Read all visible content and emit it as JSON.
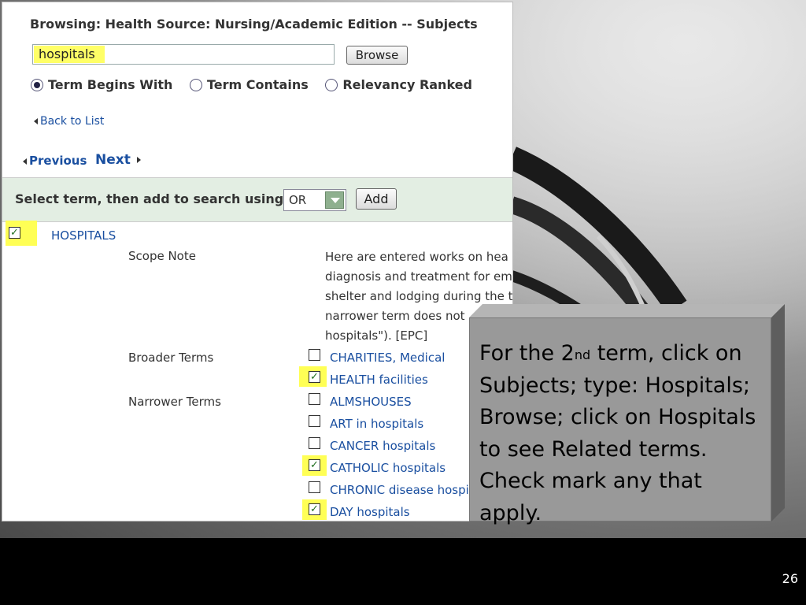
{
  "screenshot": {
    "title": "Browsing: Health Source: Nursing/Academic Edition -- Subjects",
    "search_value": "hospitals",
    "browse_button": "Browse",
    "radios": [
      {
        "label": "Term Begins With",
        "selected": true
      },
      {
        "label": "Term Contains",
        "selected": false
      },
      {
        "label": "Relevancy Ranked",
        "selected": false
      }
    ],
    "back_link": "Back to List",
    "previous_link": "Previous",
    "next_link": "Next",
    "select_label": "Select term, then add to search using:",
    "operator_value": "OR",
    "add_button": "Add",
    "main_term": "HOSPITALS",
    "scope_note_label": "Scope Note",
    "scope_note_lines": [
      "Here are entered works on hea",
      "diagnosis and treatment for em",
      "shelter and lodging during the t",
      "narrower term does not",
      "hospitals\"). [EPC]"
    ],
    "broader_label": "Broader Terms",
    "narrower_label": "Narrower Terms",
    "broader_terms": [
      {
        "label": "CHARITIES, Medical",
        "checked": false
      },
      {
        "label": "HEALTH facilities",
        "checked": true
      }
    ],
    "narrower_terms": [
      {
        "label": "ALMSHOUSES",
        "checked": false
      },
      {
        "label": "ART in hospitals",
        "checked": false
      },
      {
        "label": "CANCER hospitals",
        "checked": false
      },
      {
        "label": "CATHOLIC hospitals",
        "checked": true
      },
      {
        "label": "CHRONIC disease hospit",
        "checked": false
      },
      {
        "label": "DAY hospitals",
        "checked": true
      }
    ]
  },
  "callout": {
    "line1_pre": "For the 2",
    "line1_sup": "nd",
    "line1_post": " term, click on Subjects; type: Hospitals; Browse; click on Hospitals to see Related terms. Check mark any that apply."
  },
  "slide_number": "26",
  "colors": {
    "highlight": "#ffff55",
    "link": "#1a4fa0",
    "select_bar": "#e3eee3",
    "callout_face": "#999999"
  }
}
